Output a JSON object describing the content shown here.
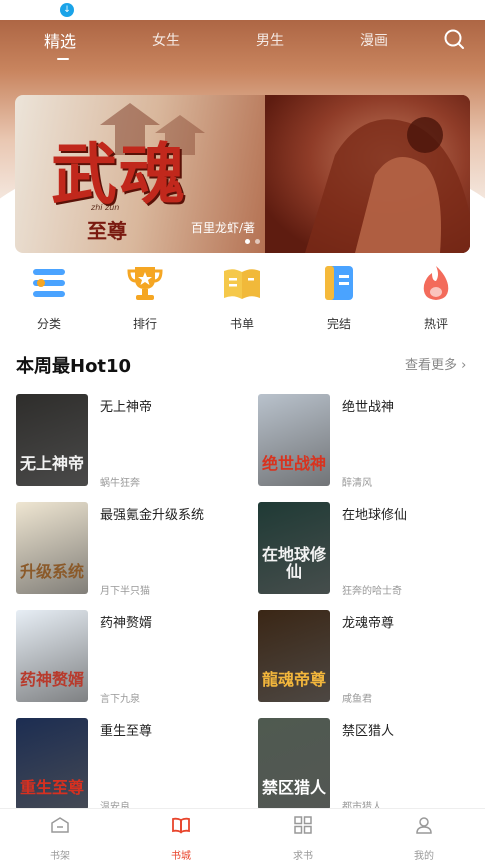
{
  "top_nav": {
    "tabs": [
      "精选",
      "女生",
      "男生",
      "漫画"
    ],
    "active_index": 0
  },
  "banner": {
    "title": "武魂",
    "subtitle_pinyin": "zhi  zūn",
    "subtitle": "至尊",
    "author": "百里龙虾/著"
  },
  "categories": [
    {
      "label": "分类",
      "icon": "list-icon",
      "color": "#4aa3ff"
    },
    {
      "label": "排行",
      "icon": "trophy-icon",
      "color": "#f5a623"
    },
    {
      "label": "书单",
      "icon": "book-list-icon",
      "color": "#f5c84a"
    },
    {
      "label": "完结",
      "icon": "book-complete-icon",
      "color": "#4aa3ff"
    },
    {
      "label": "热评",
      "icon": "flame-icon",
      "color": "#f36b5b"
    }
  ],
  "section": {
    "title": "本周最Hot10",
    "more": "查看更多 ›"
  },
  "books": [
    {
      "title": "无上神帝",
      "author": "蜗牛狂奔",
      "cover_text": "无上神帝",
      "cover_bg": "#2e2d2b",
      "cover_fg": "#f2f2f2"
    },
    {
      "title": "绝世战神",
      "author": "醉清风",
      "cover_text": "绝世战神",
      "cover_bg": "#b9c2cc",
      "cover_fg": "#d8331f"
    },
    {
      "title": "最强氪金升级系统",
      "author": "月下半只猫",
      "cover_text": "升级系统",
      "cover_bg": "#efe6d2",
      "cover_fg": "#8b5a2a"
    },
    {
      "title": "在地球修仙",
      "author": "狂奔的哈士奇",
      "cover_text": "在地球修仙",
      "cover_bg": "#1f3a35",
      "cover_fg": "#f3f3f3"
    },
    {
      "title": "药神赘婿",
      "author": "言下九泉",
      "cover_text": "药神赘婿",
      "cover_bg": "#e7eef5",
      "cover_fg": "#b83a2c"
    },
    {
      "title": "龙魂帝尊",
      "author": "咸鱼君",
      "cover_text": "龍魂帝尊",
      "cover_bg": "#3a2615",
      "cover_fg": "#f2b63c"
    },
    {
      "title": "重生至尊",
      "author": "温安良",
      "cover_text": "重生至尊",
      "cover_bg": "#1c2d52",
      "cover_fg": "#d73020"
    },
    {
      "title": "禁区猎人",
      "author": "都市猎人",
      "cover_text": "禁区猎人",
      "cover_bg": "#4f5a50",
      "cover_fg": "#ffffff"
    }
  ],
  "bottom_nav": [
    {
      "label": "书架",
      "icon": "bookshelf-icon"
    },
    {
      "label": "书城",
      "icon": "bookstore-icon"
    },
    {
      "label": "求书",
      "icon": "request-book-icon"
    },
    {
      "label": "我的",
      "icon": "profile-icon"
    }
  ],
  "bottom_nav_active": 1,
  "colors": {
    "accent": "#e8452c"
  }
}
